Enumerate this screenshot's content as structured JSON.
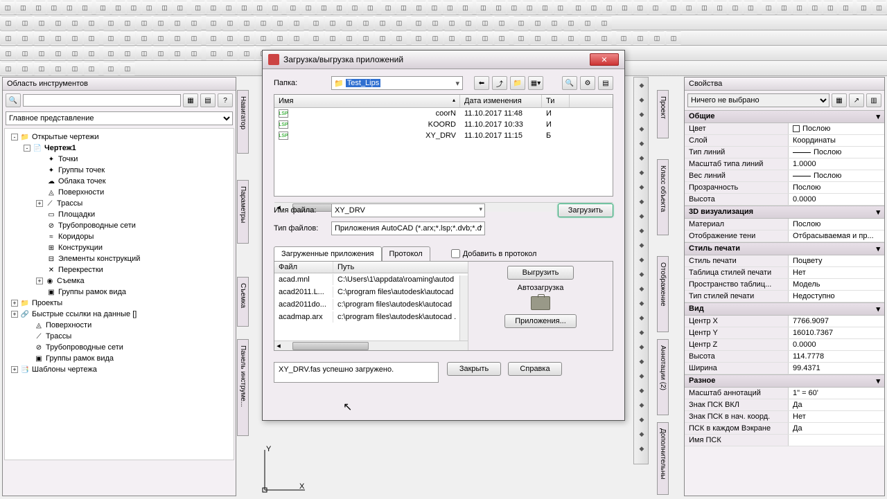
{
  "toolspace": {
    "title": "Область инструментов",
    "view_combo": "Главное представление",
    "tree": [
      {
        "ind": 0,
        "t": "-",
        "i": "📁",
        "l": "Открытые чертежи",
        "b": false
      },
      {
        "ind": 1,
        "t": "-",
        "i": "📄",
        "l": "Чертеж1",
        "b": true
      },
      {
        "ind": 2,
        "t": "",
        "i": "✦",
        "l": "Точки",
        "b": false
      },
      {
        "ind": 2,
        "t": "",
        "i": "✦",
        "l": "Группы точек",
        "b": false
      },
      {
        "ind": 2,
        "t": "",
        "i": "☁",
        "l": "Облака точек",
        "b": false
      },
      {
        "ind": 2,
        "t": "",
        "i": "◬",
        "l": "Поверхности",
        "b": false
      },
      {
        "ind": 2,
        "t": "+",
        "i": "⟋",
        "l": "Трассы",
        "b": false
      },
      {
        "ind": 2,
        "t": "",
        "i": "▭",
        "l": "Площадки",
        "b": false
      },
      {
        "ind": 2,
        "t": "",
        "i": "⊘",
        "l": "Трубопроводные сети",
        "b": false
      },
      {
        "ind": 2,
        "t": "",
        "i": "≈",
        "l": "Коридоры",
        "b": false
      },
      {
        "ind": 2,
        "t": "",
        "i": "⊞",
        "l": "Конструкции",
        "b": false
      },
      {
        "ind": 2,
        "t": "",
        "i": "⊟",
        "l": "Элементы конструкций",
        "b": false
      },
      {
        "ind": 2,
        "t": "",
        "i": "✕",
        "l": "Перекрестки",
        "b": false
      },
      {
        "ind": 2,
        "t": "+",
        "i": "◉",
        "l": "Съемка",
        "b": false
      },
      {
        "ind": 2,
        "t": "",
        "i": "▣",
        "l": "Группы рамок вида",
        "b": false
      },
      {
        "ind": 0,
        "t": "+",
        "i": "📁",
        "l": "Проекты",
        "b": false
      },
      {
        "ind": 0,
        "t": "+",
        "i": "🔗",
        "l": "Быстрые ссылки на данные []",
        "b": false
      },
      {
        "ind": 1,
        "t": "",
        "i": "◬",
        "l": "Поверхности",
        "b": false
      },
      {
        "ind": 1,
        "t": "",
        "i": "⟋",
        "l": "Трассы",
        "b": false
      },
      {
        "ind": 1,
        "t": "",
        "i": "⊘",
        "l": "Трубопроводные сети",
        "b": false
      },
      {
        "ind": 1,
        "t": "",
        "i": "▣",
        "l": "Группы рамок вида",
        "b": false
      },
      {
        "ind": 0,
        "t": "+",
        "i": "📑",
        "l": "Шаблоны чертежа",
        "b": false
      }
    ]
  },
  "vtabs": {
    "navigator": "Навигатор",
    "params": "Параметры",
    "survey": "Съемка",
    "toolpanel": "Панель инструме..."
  },
  "props": {
    "title": "Свойства",
    "none": "Ничего не выбрано",
    "sections": [
      {
        "h": "Общие",
        "rows": [
          {
            "k": "Цвет",
            "v": "Послою",
            "sw": true
          },
          {
            "k": "Слой",
            "v": "Координаты"
          },
          {
            "k": "Тип линий",
            "v": "Послою",
            "line": true
          },
          {
            "k": "Масштаб типа линий",
            "v": "1.0000"
          },
          {
            "k": "Вес линий",
            "v": "Послою",
            "line": true
          },
          {
            "k": "Прозрачность",
            "v": "Послою"
          },
          {
            "k": "Высота",
            "v": "0.0000"
          }
        ]
      },
      {
        "h": "3D визуализация",
        "rows": [
          {
            "k": "Материал",
            "v": "Послою"
          },
          {
            "k": "Отображение тени",
            "v": "Отбрасываемая и пр..."
          }
        ]
      },
      {
        "h": "Стиль печати",
        "rows": [
          {
            "k": "Стиль печати",
            "v": "Поцвету"
          },
          {
            "k": "Таблица стилей печати",
            "v": "Нет"
          },
          {
            "k": "Пространство таблиц...",
            "v": "Модель"
          },
          {
            "k": "Тип стилей печати",
            "v": "Недоступно"
          }
        ]
      },
      {
        "h": "Вид",
        "rows": [
          {
            "k": "Центр X",
            "v": "7766.9097"
          },
          {
            "k": "Центр Y",
            "v": "16010.7367"
          },
          {
            "k": "Центр Z",
            "v": "0.0000"
          },
          {
            "k": "Высота",
            "v": "114.7778"
          },
          {
            "k": "Ширина",
            "v": "99.4371"
          }
        ]
      },
      {
        "h": "Разное",
        "rows": [
          {
            "k": "Масштаб аннотаций",
            "v": "1\" = 60'"
          },
          {
            "k": "Знак ПСК ВКЛ",
            "v": "Да"
          },
          {
            "k": "Знак ПСК в нач. коорд.",
            "v": "Нет"
          },
          {
            "k": "ПСК в каждом Вэкране",
            "v": "Да"
          },
          {
            "k": "Имя ПСК",
            "v": ""
          }
        ]
      }
    ],
    "side_labels": {
      "project": "Проект",
      "class": "Класс объекта",
      "display": "Отображение",
      "annot": "Аннотации (2)",
      "extra": "Дополнительны"
    }
  },
  "dialog": {
    "title": "Загрузка/выгрузка приложений",
    "folder_label": "Папка:",
    "folder": "Test_Lips",
    "cols": {
      "name": "Имя",
      "date": "Дата изменения",
      "type": "Ти"
    },
    "files": [
      {
        "n": "coorN",
        "d": "11.10.2017 11:48",
        "t": "И"
      },
      {
        "n": "KOORD",
        "d": "11.10.2017 10:33",
        "t": "И"
      },
      {
        "n": "XY_DRV",
        "d": "11.10.2017 11:15",
        "t": "Б"
      }
    ],
    "filename_label": "Имя файла:",
    "filename": "XY_DRV",
    "filetype_label": "Тип файлов:",
    "filetype": "Приложения AutoCAD (*.arx;*.lsp;*.dvb;*.db",
    "load_btn": "Загрузить",
    "tabs": {
      "loaded": "Загруженные приложения",
      "protocol": "Протокол"
    },
    "add_protocol": "Добавить в протокол",
    "loaded_cols": {
      "file": "Файл",
      "path": "Путь"
    },
    "loaded": [
      {
        "f": "acad.mnl",
        "p": "C:\\Users\\1\\appdata\\roaming\\autod"
      },
      {
        "f": "acad2011.L...",
        "p": "C:\\program files\\autodesk\\autocad"
      },
      {
        "f": "acad2011do...",
        "p": "c:\\program files\\autodesk\\autocad"
      },
      {
        "f": "acadmap.arx",
        "p": "c:\\program files\\autodesk\\autocad ."
      }
    ],
    "unload_btn": "Выгрузить",
    "autoload": "Автозагрузка",
    "apps_btn": "Приложения...",
    "status": "XY_DRV.fas успешно загружено.",
    "close_btn": "Закрыть",
    "help_btn": "Справка"
  }
}
